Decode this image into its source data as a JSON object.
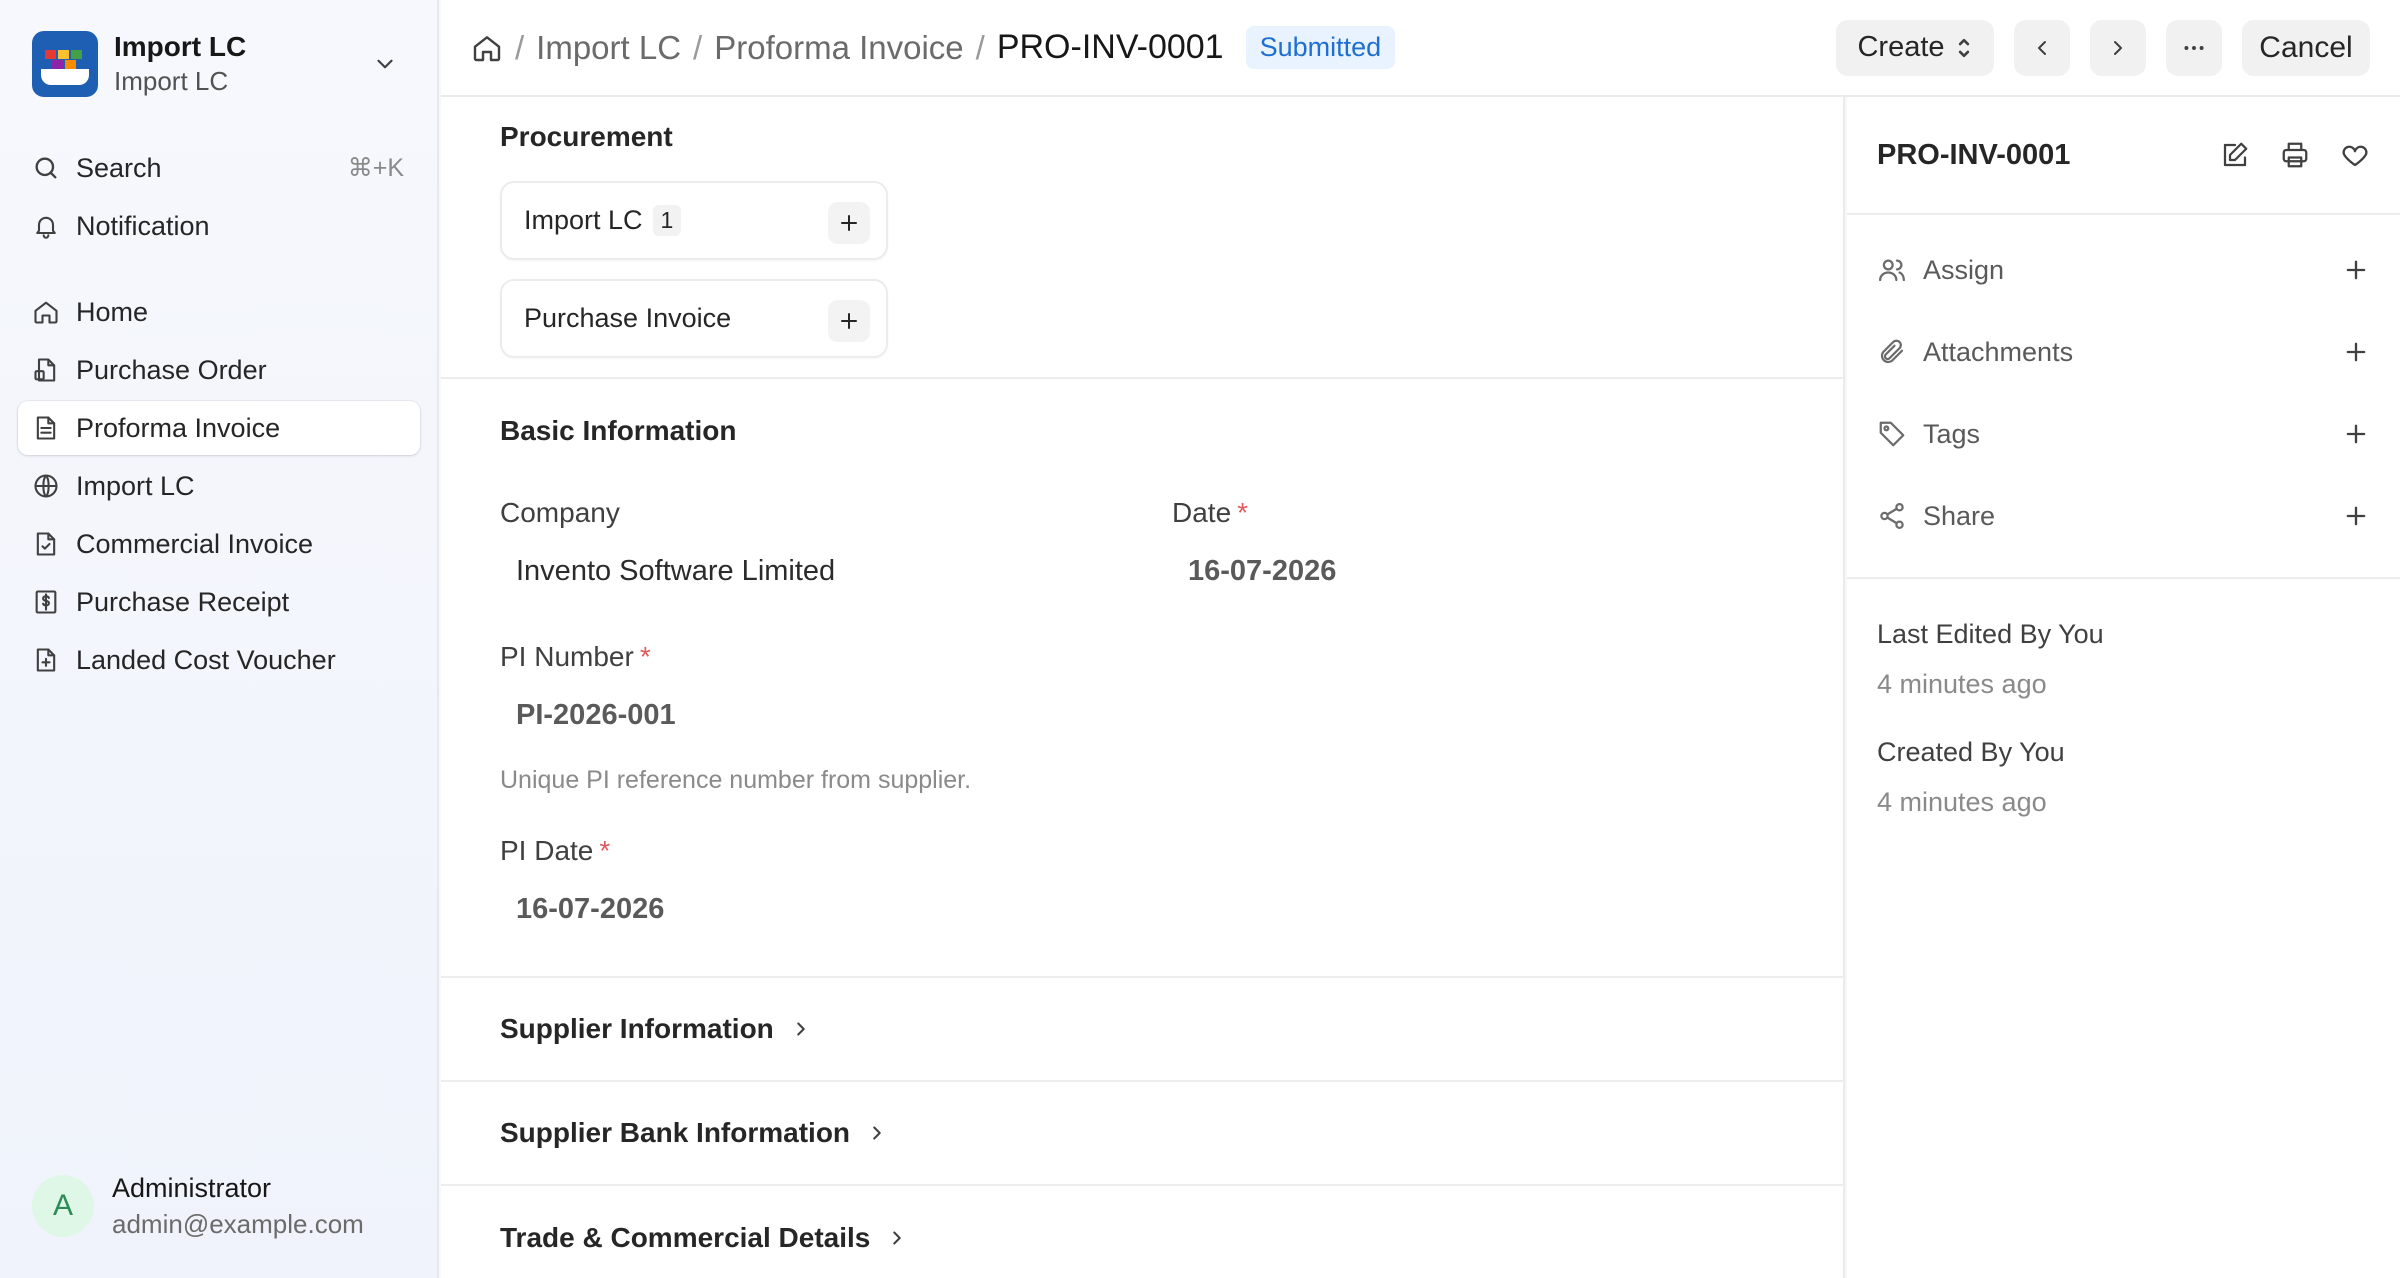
{
  "app": {
    "name": "Import LC",
    "subtitle": "Import LC"
  },
  "sidebar": {
    "search_label": "Search",
    "search_shortcut": "⌘+K",
    "notification_label": "Notification",
    "items": [
      {
        "label": "Home",
        "icon": "home-icon"
      },
      {
        "label": "Purchase Order",
        "icon": "document-box-icon"
      },
      {
        "label": "Proforma Invoice",
        "icon": "document-icon",
        "active": true
      },
      {
        "label": "Import LC",
        "icon": "globe-icon"
      },
      {
        "label": "Commercial Invoice",
        "icon": "document-check-icon"
      },
      {
        "label": "Purchase Receipt",
        "icon": "dollar-receipt-icon"
      },
      {
        "label": "Landed Cost Voucher",
        "icon": "document-plus-icon"
      }
    ],
    "user": {
      "initial": "A",
      "name": "Administrator",
      "email": "admin@example.com"
    }
  },
  "header": {
    "breadcrumb": [
      "Import LC",
      "Proforma Invoice",
      "PRO-INV-0001"
    ],
    "separator": "/",
    "status": "Submitted",
    "create_label": "Create",
    "cancel_label": "Cancel"
  },
  "procurement": {
    "title": "Procurement",
    "links": [
      {
        "label": "Import LC",
        "count": "1"
      },
      {
        "label": "Purchase Invoice"
      }
    ]
  },
  "basic_information": {
    "title": "Basic Information",
    "company": {
      "label": "Company",
      "value": "Invento Software Limited"
    },
    "date": {
      "label": "Date",
      "required": "*",
      "value": "16-07-2026"
    },
    "pi_number": {
      "label": "PI Number",
      "required": "*",
      "value": "PI-2026-001",
      "description": "Unique PI reference number from supplier."
    },
    "pi_date": {
      "label": "PI Date",
      "required": "*",
      "value": "16-07-2026"
    }
  },
  "collapsed_sections": [
    "Supplier Information",
    "Supplier Bank Information",
    "Trade & Commercial Details"
  ],
  "right_panel": {
    "doc_name": "PRO-INV-0001",
    "actions": [
      "Assign",
      "Attachments",
      "Tags",
      "Share"
    ],
    "last_edited": "Last Edited By You",
    "last_edited_time": "4 minutes ago",
    "created": "Created By You",
    "created_time": "4 minutes ago"
  },
  "colors": {
    "accent": "#1f6fd1",
    "required": "#e15b5b",
    "status_bg": "#e8f3ff"
  }
}
